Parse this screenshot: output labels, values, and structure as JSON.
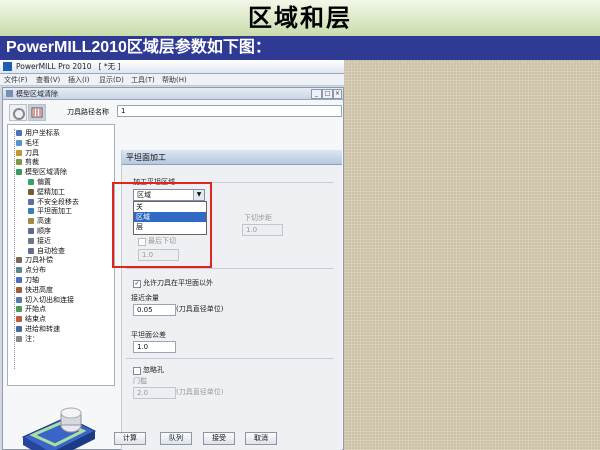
{
  "slide": {
    "title": "区域和层",
    "subtitle": "PowerMILL2010区域层参数如下图："
  },
  "app": {
    "title": "PowerMILL Pro 2010",
    "doc": "[ *无 ]",
    "menu": [
      "文件(F)",
      "查看(V)",
      "插入(I)",
      "显示(D)",
      "工具(T)",
      "帮助(H)"
    ]
  },
  "dialog": {
    "title": "模型区域清除",
    "path_name_label": "刀具路径名称",
    "path_name_value": "1",
    "tree": [
      {
        "label": "用户坐标系",
        "icon_color": "#4a70c0"
      },
      {
        "label": "毛坯",
        "icon_color": "#5a8fd0"
      },
      {
        "label": "刀具",
        "icon_color": "#c09a30"
      },
      {
        "label": "剪裁",
        "icon_color": "#7a9a40"
      },
      {
        "label": "模型区域清除",
        "icon_color": "#3a9a5a"
      },
      {
        "label": "偏置",
        "icon_color": "#3aa070"
      },
      {
        "label": "壁精加工",
        "icon_color": "#7a5a30"
      },
      {
        "label": "不安全段移去",
        "icon_color": "#5a70a0"
      },
      {
        "label": "平坦面加工",
        "icon_color": "#3a80b0"
      },
      {
        "label": "高速",
        "icon_color": "#a08a40"
      },
      {
        "label": "顺序",
        "icon_color": "#5a6a9a"
      },
      {
        "label": "接近",
        "icon_color": "#6a7a8a"
      },
      {
        "label": "自动检查",
        "icon_color": "#6a6a9a"
      },
      {
        "label": "刀具补偿",
        "icon_color": "#7a6a5a"
      },
      {
        "label": "点分布",
        "icon_color": "#5a8a8a"
      },
      {
        "label": "刀轴",
        "icon_color": "#4a70c0"
      },
      {
        "label": "快进高度",
        "icon_color": "#a05a40"
      },
      {
        "label": "切入切出和连接",
        "icon_color": "#5a7ab0"
      },
      {
        "label": "开始点",
        "icon_color": "#4a9a5a"
      },
      {
        "label": "结束点",
        "icon_color": "#c05a40"
      },
      {
        "label": "进给和转速",
        "icon_color": "#4a6a9a"
      },
      {
        "label": "注：",
        "icon_color": "#888888"
      }
    ],
    "panel": {
      "header": "平坦面加工",
      "region_group_label": "加工平坦区域",
      "region_value": "区域",
      "dropdown_options": [
        "关",
        "区域",
        "层"
      ],
      "dropdown_selected_index": 1,
      "down_step_label": "下切步距",
      "down_step_value": "1.0",
      "final_down_label": "最后下切",
      "final_down_value": "1.0",
      "allow_over_label": "允许刀具在平坦面以外",
      "approach_allow_label": "接近余量",
      "approach_allow_value": "0.05",
      "tool_dia_unit": "(刀具直径单位)",
      "flat_tol_label": "平坦面公差",
      "flat_tol_value": "1.0",
      "ignore_holes_label": "忽略孔",
      "threshold_label": "门槛",
      "threshold_value": "2.0"
    },
    "buttons": [
      "计算",
      "队列",
      "接受",
      "取消"
    ]
  }
}
